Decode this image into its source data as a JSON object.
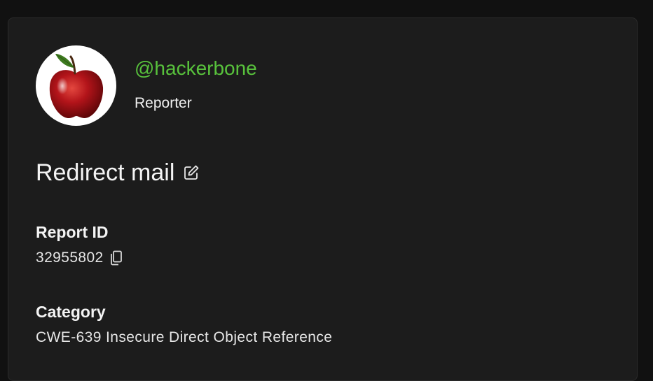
{
  "reporter": {
    "username": "@hackerbone",
    "role": "Reporter",
    "avatar_icon": "apple-avatar"
  },
  "report": {
    "title": "Redirect mail",
    "edit_icon": "edit-icon",
    "id_label": "Report ID",
    "id_value": "32955802",
    "copy_icon": "copy-icon",
    "category_label": "Category",
    "category_value": "CWE-639 Insecure Direct Object Reference"
  },
  "colors": {
    "accent_username": "#58c23c",
    "card_background": "#1c1c1c",
    "page_background": "#111111"
  }
}
